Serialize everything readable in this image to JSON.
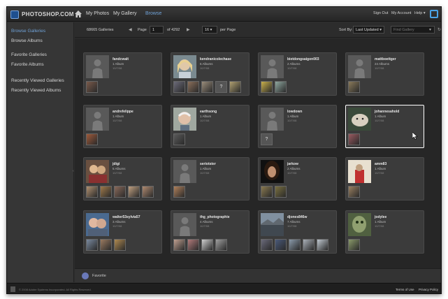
{
  "app": {
    "logo_text": "PHOTOSHOP.COM"
  },
  "nav": {
    "my_photos": "My Photos",
    "my_gallery": "My Gallery",
    "browse": "Browse"
  },
  "top_right": {
    "sign_out": "Sign Out",
    "my_account": "My Account",
    "help": "Help ▾"
  },
  "sidebar": {
    "items": [
      {
        "label": "Browse Galleries",
        "active": true
      },
      {
        "label": "Browse Albums",
        "active": false
      },
      {
        "label": "Favorite Galleries",
        "active": false
      },
      {
        "label": "Favorite Albums",
        "active": false
      },
      {
        "label": "Recently Viewed Galleries",
        "active": false
      },
      {
        "label": "Recently Viewed Albums",
        "active": false
      }
    ]
  },
  "toolbar": {
    "galleries_count": "68665 Galleries",
    "page_label": "Page",
    "page_value": "1",
    "page_total": "of 4292",
    "per_page_value": "16",
    "per_page_label": "per Page",
    "sort_label": "Sort By:",
    "sort_value": "Last Updated",
    "find_placeholder": "Find Gallery"
  },
  "galleries": [
    {
      "name": "fandcwalt",
      "albums": "1 Album",
      "date": "10/7/08",
      "avatar": "placeholder",
      "thumbs": [
        "#7a5a4a"
      ]
    },
    {
      "name": "kendranicolechase",
      "albums": "6 Albums",
      "date": "10/7/08",
      "avatar": "photo-blonde",
      "thumbs": [
        "#6b6a78",
        "#8a6f5a",
        "#9a8c7a",
        "?",
        "#b0a070"
      ]
    },
    {
      "name": "bietdongsaigon003",
      "albums": "2 Albums",
      "date": "10/7/08",
      "avatar": "placeholder",
      "thumbs": [
        "#c9b04a",
        "#8fa8a0"
      ]
    },
    {
      "name": "mattboettger",
      "albums": "24 Albums",
      "date": "10/7/08",
      "avatar": "placeholder",
      "thumbs": [
        "#8a7a5a"
      ]
    },
    {
      "name": "andrefelippe",
      "albums": "1 Album",
      "date": "10/7/08",
      "avatar": "placeholder",
      "thumbs": [
        "#a05a3a"
      ]
    },
    {
      "name": "earthsong",
      "albums": "1 Album",
      "date": "10/7/08",
      "avatar": "photo-oldman",
      "thumbs": [
        "#5a5a5a"
      ]
    },
    {
      "name": "lowdown",
      "albums": "1 Album",
      "date": "10/7/08",
      "avatar": "placeholder",
      "thumbs": [
        "?"
      ]
    },
    {
      "name": "johannesahold",
      "albums": "1 Album",
      "date": "10/7/08",
      "avatar": "photo-cat",
      "thumbs": [
        "#9a5a60"
      ],
      "selected": true
    },
    {
      "name": "jdigi",
      "albums": "5 Albums",
      "date": "10/7/08",
      "avatar": "photo-group",
      "thumbs": [
        "#b09070",
        "#a07a4a",
        "#8a6a5a",
        "#c0a080",
        "#b08a70"
      ]
    },
    {
      "name": "seriotster",
      "albums": "1 Album",
      "date": "10/7/08",
      "avatar": "placeholder",
      "thumbs": [
        "#b0805a"
      ]
    },
    {
      "name": "jarkow",
      "albums": "2 Albums",
      "date": "10/7/08",
      "avatar": "photo-hair",
      "thumbs": [
        "#8a7a50",
        "#7a7040"
      ]
    },
    {
      "name": "amm83",
      "albums": "1 Album",
      "date": "10/7/08",
      "avatar": "photo-red",
      "thumbs": [
        "#9a8060"
      ]
    },
    {
      "name": "walter53sylvia57",
      "albums": "3 Albums",
      "date": "10/7/08",
      "avatar": "photo-couple",
      "thumbs": [
        "#7a8aa0",
        "#9a7a60",
        "#b08a50"
      ]
    },
    {
      "name": "thg_photographie",
      "albums": "4 Albums",
      "date": "10/7/08",
      "avatar": "placeholder",
      "thumbs": [
        "#c0a090",
        "#b07a7a",
        "#d0d0d0",
        "#a0a0a0"
      ]
    },
    {
      "name": "djones846w",
      "albums": "7 Albums",
      "date": "10/7/08",
      "avatar": "photo-landscape",
      "thumbs": [
        "#6a6a7a",
        "#4a5a7a",
        "#8a9aaa",
        "#aab0b8",
        "#c0c8d0"
      ]
    },
    {
      "name": "jodylee",
      "albums": "1 Album",
      "date": "10/7/08",
      "avatar": "photo-green",
      "thumbs": [
        "#8a9a6a"
      ]
    }
  ],
  "favorites_bar": {
    "label": "Favorite"
  },
  "footer": {
    "copyright": "© 2008 Adobe Systems Incorporated. All Rights Reserved.",
    "terms": "Terms of Use",
    "privacy": "Privacy Policy"
  },
  "colors": {
    "accent": "#6fa1d6",
    "background": "#2e2e2e",
    "card": "#3b3b3b"
  }
}
